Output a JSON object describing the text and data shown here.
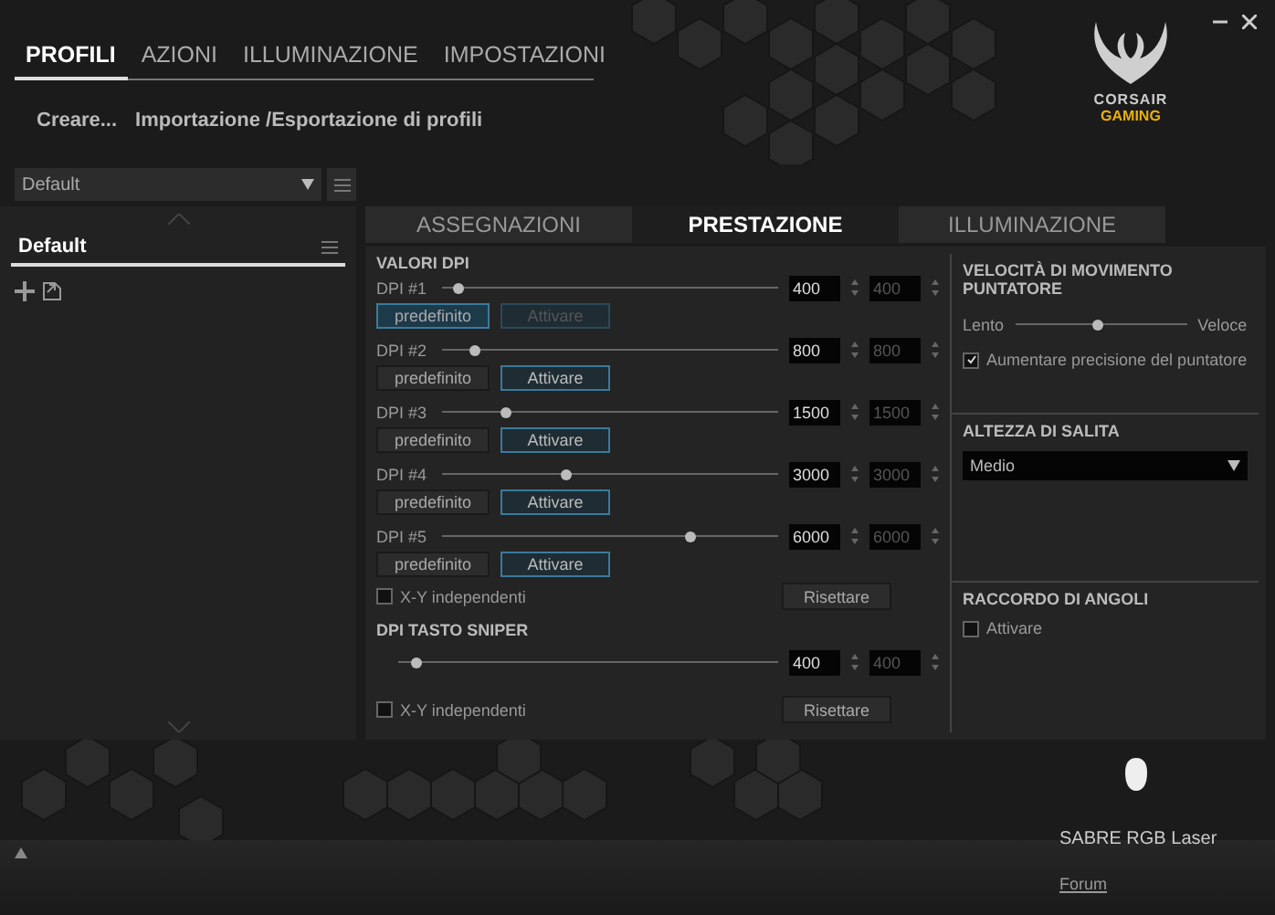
{
  "nav": {
    "tabs": [
      {
        "label": "PROFILI",
        "selected": true
      },
      {
        "label": "AZIONI",
        "selected": false
      },
      {
        "label": "ILLUMINAZIONE",
        "selected": false
      },
      {
        "label": "IMPOSTAZIONI",
        "selected": false
      }
    ]
  },
  "subnav": {
    "links": [
      "Creare...",
      "Importazione /Esportazione di profili"
    ]
  },
  "logo": {
    "line1": "CORSAIR",
    "line2": "GAMING"
  },
  "profiles": {
    "dropdown": "Default",
    "items": [
      {
        "label": "Default",
        "selected": true
      }
    ]
  },
  "tabs": [
    {
      "label": "ASSEGNAZIONI",
      "selected": false
    },
    {
      "label": "PRESTAZIONE",
      "selected": true
    },
    {
      "label": "ILLUMINAZIONE",
      "selected": false
    }
  ],
  "dpi": {
    "title": "VALORI DPI",
    "rows": [
      {
        "label": "DPI #1",
        "level": 0.05,
        "x_value": "400",
        "y_value": "400",
        "default_button": {
          "label": "predefinito",
          "selected": true
        },
        "activate_button": {
          "label": "Attivare",
          "disabled": true
        }
      },
      {
        "label": "DPI #2",
        "level": 0.1,
        "x_value": "800",
        "y_value": "800",
        "default_button": {
          "label": "predefinito",
          "selected": false
        },
        "activate_button": {
          "label": "Attivare",
          "disabled": false
        }
      },
      {
        "label": "DPI #3",
        "level": 0.19,
        "x_value": "1500",
        "y_value": "1500",
        "default_button": {
          "label": "predefinito",
          "selected": false
        },
        "activate_button": {
          "label": "Attivare",
          "disabled": false
        }
      },
      {
        "label": "DPI #4",
        "level": 0.37,
        "x_value": "3000",
        "y_value": "3000",
        "default_button": {
          "label": "predefinito",
          "selected": false
        },
        "activate_button": {
          "label": "Attivare",
          "disabled": false
        }
      },
      {
        "label": "DPI #5",
        "level": 0.74,
        "x_value": "6000",
        "y_value": "6000",
        "default_button": {
          "label": "predefinito",
          "selected": false
        },
        "activate_button": {
          "label": "Attivare",
          "disabled": false
        }
      }
    ],
    "xy_independent": {
      "label": "X-Y independenti",
      "checked": false
    },
    "reset": "Risettare"
  },
  "sniper": {
    "title": "DPI TASTO SNIPER",
    "level": 0.05,
    "x_value": "400",
    "y_value": "400",
    "xy_independent": {
      "label": "X-Y independenti",
      "checked": false
    },
    "reset": "Risettare"
  },
  "pointer_speed": {
    "title": "VELOCITÀ DI MOVIMENTO PUNTATORE",
    "min_label": "Lento",
    "max_label": "Veloce",
    "level": 0.48,
    "precision": {
      "label": "Aumentare precisione del puntatore",
      "checked": true
    }
  },
  "lift_height": {
    "title": "ALTEZZA DI SALITA",
    "value": "Medio"
  },
  "angle_snapping": {
    "title": "RACCORDO DI ANGOLI",
    "checkbox": {
      "label": "Attivare",
      "checked": false
    }
  },
  "device": {
    "name": "SABRE RGB Laser",
    "link": "Forum"
  }
}
